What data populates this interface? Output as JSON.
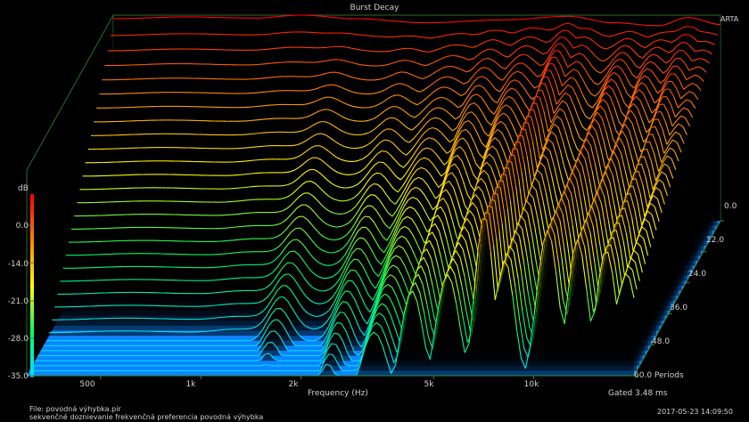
{
  "chart_data": {
    "type": "waterfall-3d",
    "title": "Burst Decay",
    "brand": "ARTA",
    "xlabel": "Frequency (Hz)",
    "x_scale": "log",
    "x_ticks": [
      "500",
      "1k",
      "2k",
      "5k",
      "10k"
    ],
    "x_tick_values": [
      500,
      1000,
      2000,
      5000,
      10000
    ],
    "xlim": [
      300,
      20000
    ],
    "z_unit_label": "dB",
    "z_ticks": [
      "-35.0",
      "-28.0",
      "-21.0",
      "-14.0",
      "-7.0",
      "0.0"
    ],
    "zlim": [
      -35,
      0
    ],
    "depth_ticks": [
      "0.0",
      "12.0",
      "24.0",
      "36.0",
      "48.0",
      "60.0 Periods"
    ],
    "depth_range": [
      0,
      60
    ],
    "colormap": [
      "#00e0ff",
      "#00ff60",
      "#ffff00",
      "#ff8800",
      "#ff0000"
    ],
    "floor_color": "#0a84ff",
    "gated_text": "Gated 3.48 ms",
    "file_line1": "File: povodná výhybka.pir",
    "file_line2": "sekvenčné doznievanie frekvenčná preferencia  povodná výhybka",
    "datetime": "2017-05-23  14:09:50",
    "peaks_db_at_0_periods": [
      {
        "freq": 300,
        "db": -0.6
      },
      {
        "freq": 500,
        "db": -0.3
      },
      {
        "freq": 800,
        "db": -0.5
      },
      {
        "freq": 1100,
        "db": 0
      },
      {
        "freq": 1600,
        "db": -0.6
      },
      {
        "freq": 2600,
        "db": -1.3
      },
      {
        "freq": 4500,
        "db": -0.8
      },
      {
        "freq": 7000,
        "db": -0.2
      },
      {
        "freq": 9500,
        "db": -1.3
      },
      {
        "freq": 13000,
        "db": -1.8
      },
      {
        "freq": 16000,
        "db": -0.4
      },
      {
        "freq": 20000,
        "db": -1.6
      }
    ]
  }
}
